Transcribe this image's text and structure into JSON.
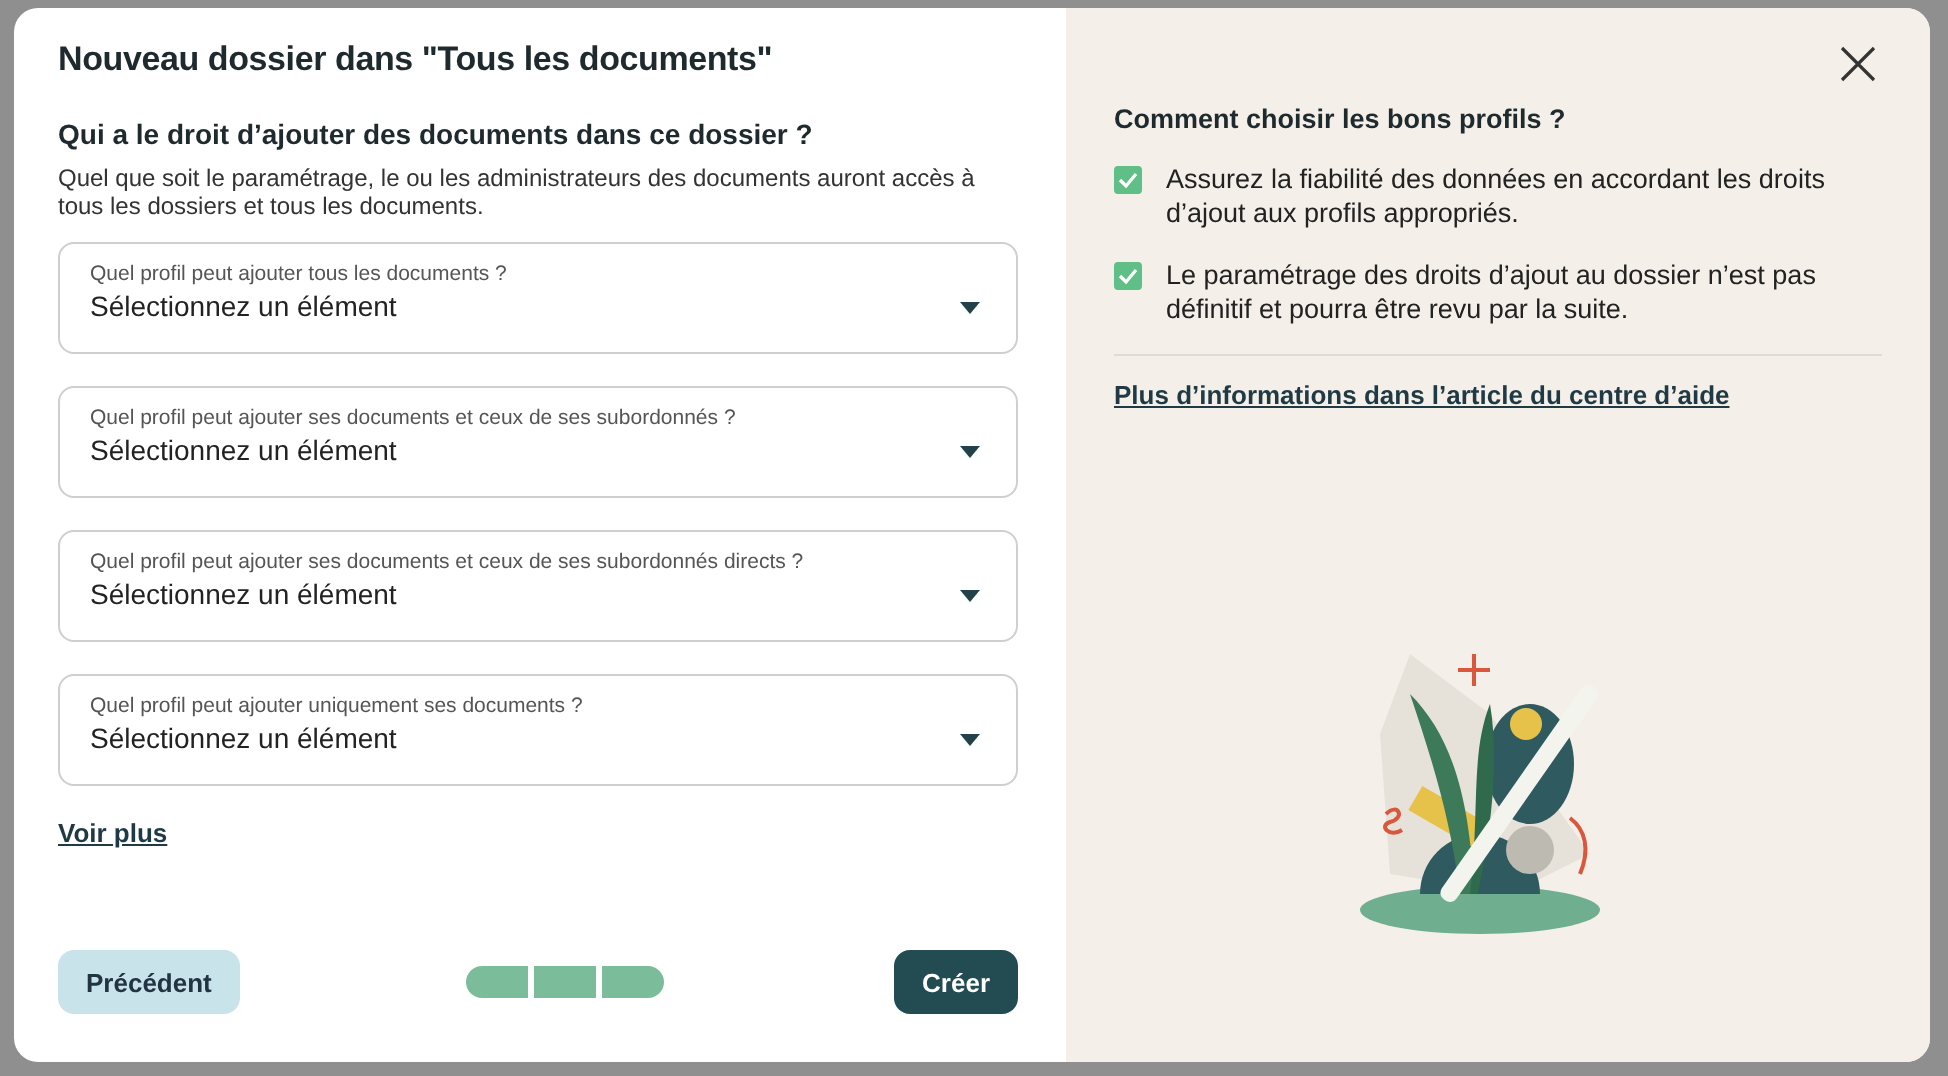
{
  "dialog": {
    "title": "Nouveau dossier dans \"Tous les documents\"",
    "question": "Qui a le droit d’ajouter des documents dans ce dossier ?",
    "description": "Quel que soit le paramétrage, le ou les administrateurs des documents auront accès à tous les dossiers et tous les documents.",
    "selects": [
      {
        "label": "Quel profil peut ajouter tous les documents ?",
        "placeholder": "Sélectionnez un élément"
      },
      {
        "label": "Quel profil peut ajouter ses documents et ceux de ses subordonnés ?",
        "placeholder": "Sélectionnez un élément"
      },
      {
        "label": "Quel profil peut ajouter ses documents et ceux de ses subordonnés directs ?",
        "placeholder": "Sélectionnez un élément"
      },
      {
        "label": "Quel profil peut ajouter uniquement ses documents ?",
        "placeholder": "Sélectionnez un élément"
      }
    ],
    "more_link": "Voir plus",
    "previous_button": "Précédent",
    "steps": [
      {
        "done": true
      },
      {
        "done": true
      },
      {
        "done": true
      }
    ],
    "create_button": "Créer"
  },
  "help": {
    "title": "Comment choisir les bons profils ?",
    "tips": [
      {
        "text": "Assurez la fiabilité des données en accordant les droits d’ajout aux profils appropriés.",
        "checked": true
      },
      {
        "text": "Le paramétrage des droits d’ajout au dossier n’est pas définitif et pourra être revu par la suite.",
        "checked": true
      }
    ],
    "link": "Plus d’informations dans l’article du centre d’aide"
  }
}
